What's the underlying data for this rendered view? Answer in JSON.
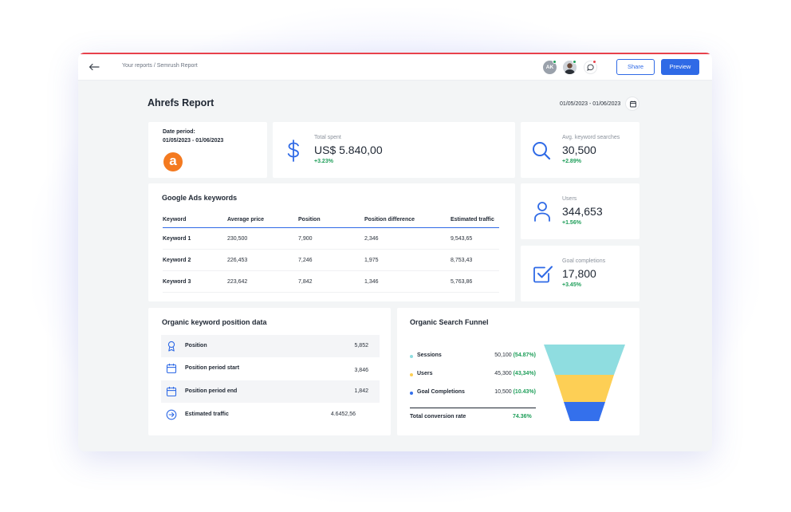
{
  "header": {
    "breadcrumb": "Your reports / Semrush Report",
    "avatar_initials": "AK",
    "share_label": "Share",
    "preview_label": "Preview"
  },
  "report": {
    "title": "Ahrefs Report",
    "date_range": "01/05/2023 - 01/06/2023"
  },
  "date_card": {
    "label": "Date period:",
    "value": "01/05/2023 - 01/06/2023",
    "logo_letter": "a",
    "logo_color": "#f47a20"
  },
  "kpis": {
    "total_spent": {
      "label": "Total spent",
      "value": "US$ 5.840,00",
      "delta": "+3.23%"
    },
    "avg_keyword": {
      "label": "Avg. keyword searches",
      "value": "30,500",
      "delta": "+2.89%"
    },
    "users": {
      "label": "Users",
      "value": "344,653",
      "delta": "+1.56%"
    },
    "goal_completions": {
      "label": "Goal completions",
      "value": "17,800",
      "delta": "+3.45%"
    }
  },
  "keywords": {
    "title": "Google Ads keywords",
    "columns": [
      "Keyword",
      "Average price",
      "Position",
      "Position difference",
      "Estimated traffic"
    ],
    "rows": [
      [
        "Keyword 1",
        "230,500",
        "7,900",
        "2,346",
        "9,543,65"
      ],
      [
        "Keyword 2",
        "226,453",
        "7,246",
        "1,975",
        "8,753,43"
      ],
      [
        "Keyword 3",
        "223,642",
        "7,842",
        "1,346",
        "5,763,86"
      ]
    ]
  },
  "organic_position": {
    "title": "Organic keyword position data",
    "rows": [
      {
        "label": "Position",
        "value": "5,852",
        "icon": "award-icon"
      },
      {
        "label": "Position period start",
        "value": "3,846",
        "icon": "calendar-icon"
      },
      {
        "label": "Position period end",
        "value": "1,842",
        "icon": "calendar-icon"
      },
      {
        "label": "Estimated traffic",
        "value": "4.6452,56",
        "icon": "arrow-circle-icon"
      }
    ]
  },
  "funnel": {
    "title": "Organic Search Funnel",
    "rows": [
      {
        "label": "Sessions",
        "value": "50,100",
        "pct": "(54.87%)",
        "color": "#8fdde0"
      },
      {
        "label": "Users",
        "value": "45,300",
        "pct": "(43,34%)",
        "color": "#fdcf55"
      },
      {
        "label": "Goal Completions",
        "value": "10,500",
        "pct": "(10.43%)",
        "color": "#3470ec"
      }
    ],
    "total_label": "Total conversion rate",
    "total_value": "74.36%"
  },
  "colors": {
    "accent": "#2f6ae6",
    "positive": "#1e9e59",
    "top_border": "#e8414b"
  }
}
